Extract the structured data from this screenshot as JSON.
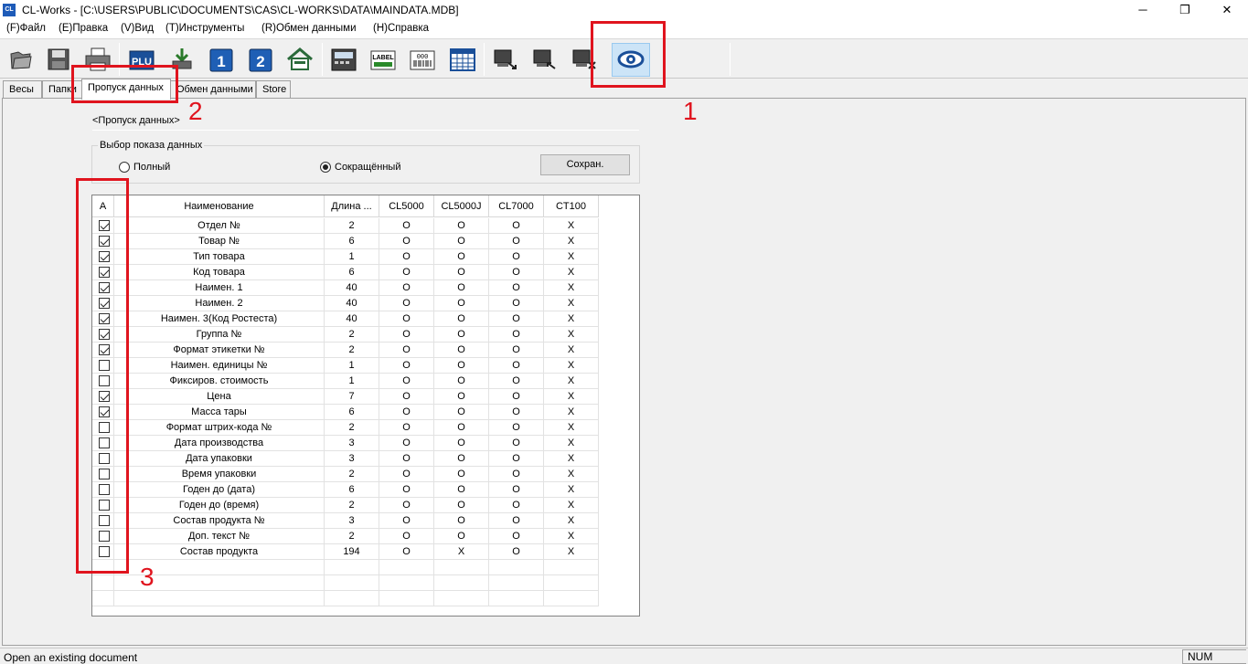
{
  "window": {
    "title": "CL-Works - [C:\\USERS\\PUBLIC\\DOCUMENTS\\CAS\\CL-WORKS\\DATA\\MAINDATA.MDB]",
    "app_icon_text": "CL"
  },
  "menu": [
    "(F)Файл",
    "(E)Правка",
    "(V)Вид",
    "(T)Инструменты",
    "(R)Обмен данными",
    "(H)Справка"
  ],
  "toolbar": {
    "buttons": [
      {
        "icon": "open-folder-icon"
      },
      {
        "icon": "save-icon"
      },
      {
        "icon": "print-icon"
      },
      {
        "icon": "plu-icon",
        "label": "PLU"
      },
      {
        "icon": "download-icon"
      },
      {
        "icon": "number-1-icon",
        "label": "1"
      },
      {
        "icon": "number-2-icon",
        "label": "2"
      },
      {
        "icon": "store-icon"
      },
      {
        "icon": "scale-device-icon"
      },
      {
        "icon": "label-icon",
        "label": "LABEL"
      },
      {
        "icon": "barcode-icon",
        "label": "000"
      },
      {
        "icon": "table-grid-icon"
      },
      {
        "icon": "send-scale-icon"
      },
      {
        "icon": "receive-scale-icon"
      },
      {
        "icon": "delete-scale-icon"
      },
      {
        "icon": "settings-eye-icon"
      }
    ],
    "active_index": 15
  },
  "tabs": [
    "Весы",
    "Папки",
    "Пропуск данных",
    "Обмен данными",
    "Store"
  ],
  "active_tab": 2,
  "section_title": "<Пропуск данных>",
  "display_group": {
    "label": "Выбор показа данных",
    "options": [
      "Полный",
      "Сокращённый"
    ],
    "selected": 1,
    "save_button": "Сохран."
  },
  "grid": {
    "columns": [
      "A",
      "Наименование",
      "Длина ...",
      "CL5000",
      "CL5000J",
      "CL7000",
      "CT100"
    ],
    "rows": [
      {
        "checked": true,
        "name": "Отдел №",
        "len": "2",
        "cl5000": "O",
        "cl5000j": "O",
        "cl7000": "O",
        "ct100": "X"
      },
      {
        "checked": true,
        "name": "Товар №",
        "len": "6",
        "cl5000": "O",
        "cl5000j": "O",
        "cl7000": "O",
        "ct100": "X"
      },
      {
        "checked": true,
        "name": "Тип товара",
        "len": "1",
        "cl5000": "O",
        "cl5000j": "O",
        "cl7000": "O",
        "ct100": "X"
      },
      {
        "checked": true,
        "name": "Код товара",
        "len": "6",
        "cl5000": "O",
        "cl5000j": "O",
        "cl7000": "O",
        "ct100": "X"
      },
      {
        "checked": true,
        "name": "Наимен. 1",
        "len": "40",
        "cl5000": "O",
        "cl5000j": "O",
        "cl7000": "O",
        "ct100": "X"
      },
      {
        "checked": true,
        "name": "Наимен. 2",
        "len": "40",
        "cl5000": "O",
        "cl5000j": "O",
        "cl7000": "O",
        "ct100": "X"
      },
      {
        "checked": true,
        "name": "Наимен. 3(Код Ростеста)",
        "len": "40",
        "cl5000": "O",
        "cl5000j": "O",
        "cl7000": "O",
        "ct100": "X"
      },
      {
        "checked": true,
        "name": "Группа №",
        "len": "2",
        "cl5000": "O",
        "cl5000j": "O",
        "cl7000": "O",
        "ct100": "X"
      },
      {
        "checked": true,
        "name": "Формат этикетки №",
        "len": "2",
        "cl5000": "O",
        "cl5000j": "O",
        "cl7000": "O",
        "ct100": "X"
      },
      {
        "checked": false,
        "name": "Наимен. единицы №",
        "len": "1",
        "cl5000": "O",
        "cl5000j": "O",
        "cl7000": "O",
        "ct100": "X"
      },
      {
        "checked": false,
        "name": "Фиксиров. стоимость",
        "len": "1",
        "cl5000": "O",
        "cl5000j": "O",
        "cl7000": "O",
        "ct100": "X"
      },
      {
        "checked": true,
        "name": "Цена",
        "len": "7",
        "cl5000": "O",
        "cl5000j": "O",
        "cl7000": "O",
        "ct100": "X"
      },
      {
        "checked": true,
        "name": "Масса тары",
        "len": "6",
        "cl5000": "O",
        "cl5000j": "O",
        "cl7000": "O",
        "ct100": "X"
      },
      {
        "checked": false,
        "name": "Формат штрих-кода №",
        "len": "2",
        "cl5000": "O",
        "cl5000j": "O",
        "cl7000": "O",
        "ct100": "X"
      },
      {
        "checked": false,
        "name": "Дата производства",
        "len": "3",
        "cl5000": "O",
        "cl5000j": "O",
        "cl7000": "O",
        "ct100": "X"
      },
      {
        "checked": false,
        "name": "Дата упаковки",
        "len": "3",
        "cl5000": "O",
        "cl5000j": "O",
        "cl7000": "O",
        "ct100": "X"
      },
      {
        "checked": false,
        "name": "Время упаковки",
        "len": "2",
        "cl5000": "O",
        "cl5000j": "O",
        "cl7000": "O",
        "ct100": "X"
      },
      {
        "checked": false,
        "name": "Годен до (дата)",
        "len": "6",
        "cl5000": "O",
        "cl5000j": "O",
        "cl7000": "O",
        "ct100": "X"
      },
      {
        "checked": false,
        "name": "Годен до (время)",
        "len": "2",
        "cl5000": "O",
        "cl5000j": "O",
        "cl7000": "O",
        "ct100": "X"
      },
      {
        "checked": false,
        "name": "Состав продукта №",
        "len": "3",
        "cl5000": "O",
        "cl5000j": "O",
        "cl7000": "O",
        "ct100": "X"
      },
      {
        "checked": false,
        "name": "Доп. текст №",
        "len": "2",
        "cl5000": "O",
        "cl5000j": "O",
        "cl7000": "O",
        "ct100": "X"
      },
      {
        "checked": false,
        "name": "Состав продукта",
        "len": "194",
        "cl5000": "O",
        "cl5000j": "X",
        "cl7000": "O",
        "ct100": "X"
      }
    ]
  },
  "annotations": [
    "1",
    "2",
    "3"
  ],
  "annotation_color": "#e0141e",
  "status": {
    "text": "Open an existing document",
    "indicator": "NUM"
  }
}
